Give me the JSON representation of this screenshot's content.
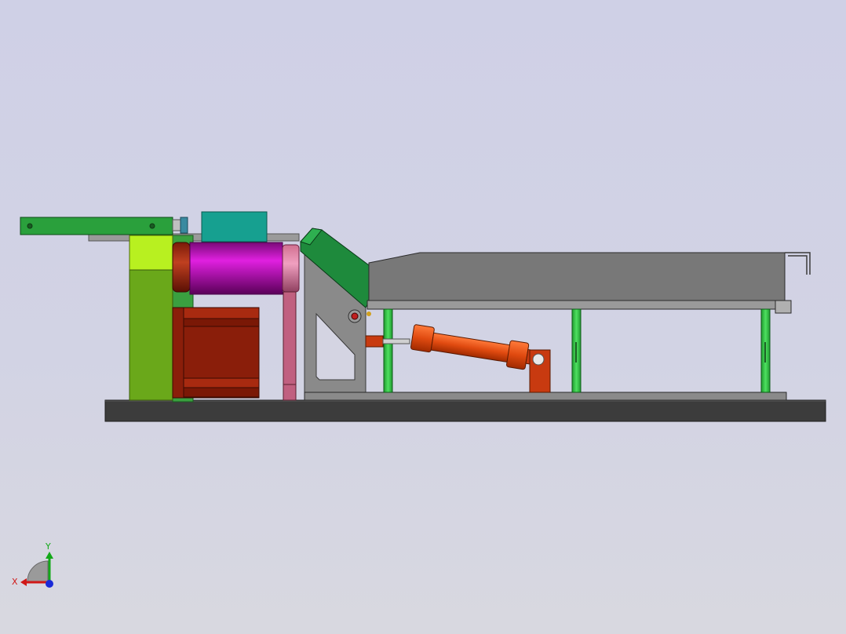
{
  "viewport": {
    "background_top": "#cfd0e6",
    "background_bottom": "#d8d8e0"
  },
  "triad": {
    "x_label": "X",
    "y_label": "Y",
    "x_color": "#d01818",
    "y_color": "#12a818",
    "z_color": "#1a2ad8"
  },
  "colors": {
    "base_plate": "#3c3c3c",
    "frame_gray": "#8a8a8a",
    "top_bracket": "#2aa03c",
    "lime_block": "#7cc41c",
    "magenta_roller": "#c010c0",
    "teal_box": "#16a090",
    "motor_red": "#8a1e0a",
    "pink_plate": "#c06080",
    "hopper_green": "#1e8a3c",
    "hopper_gray": "#787878",
    "green_post": "#30c040",
    "cylinder_orange": "#e04a10"
  }
}
